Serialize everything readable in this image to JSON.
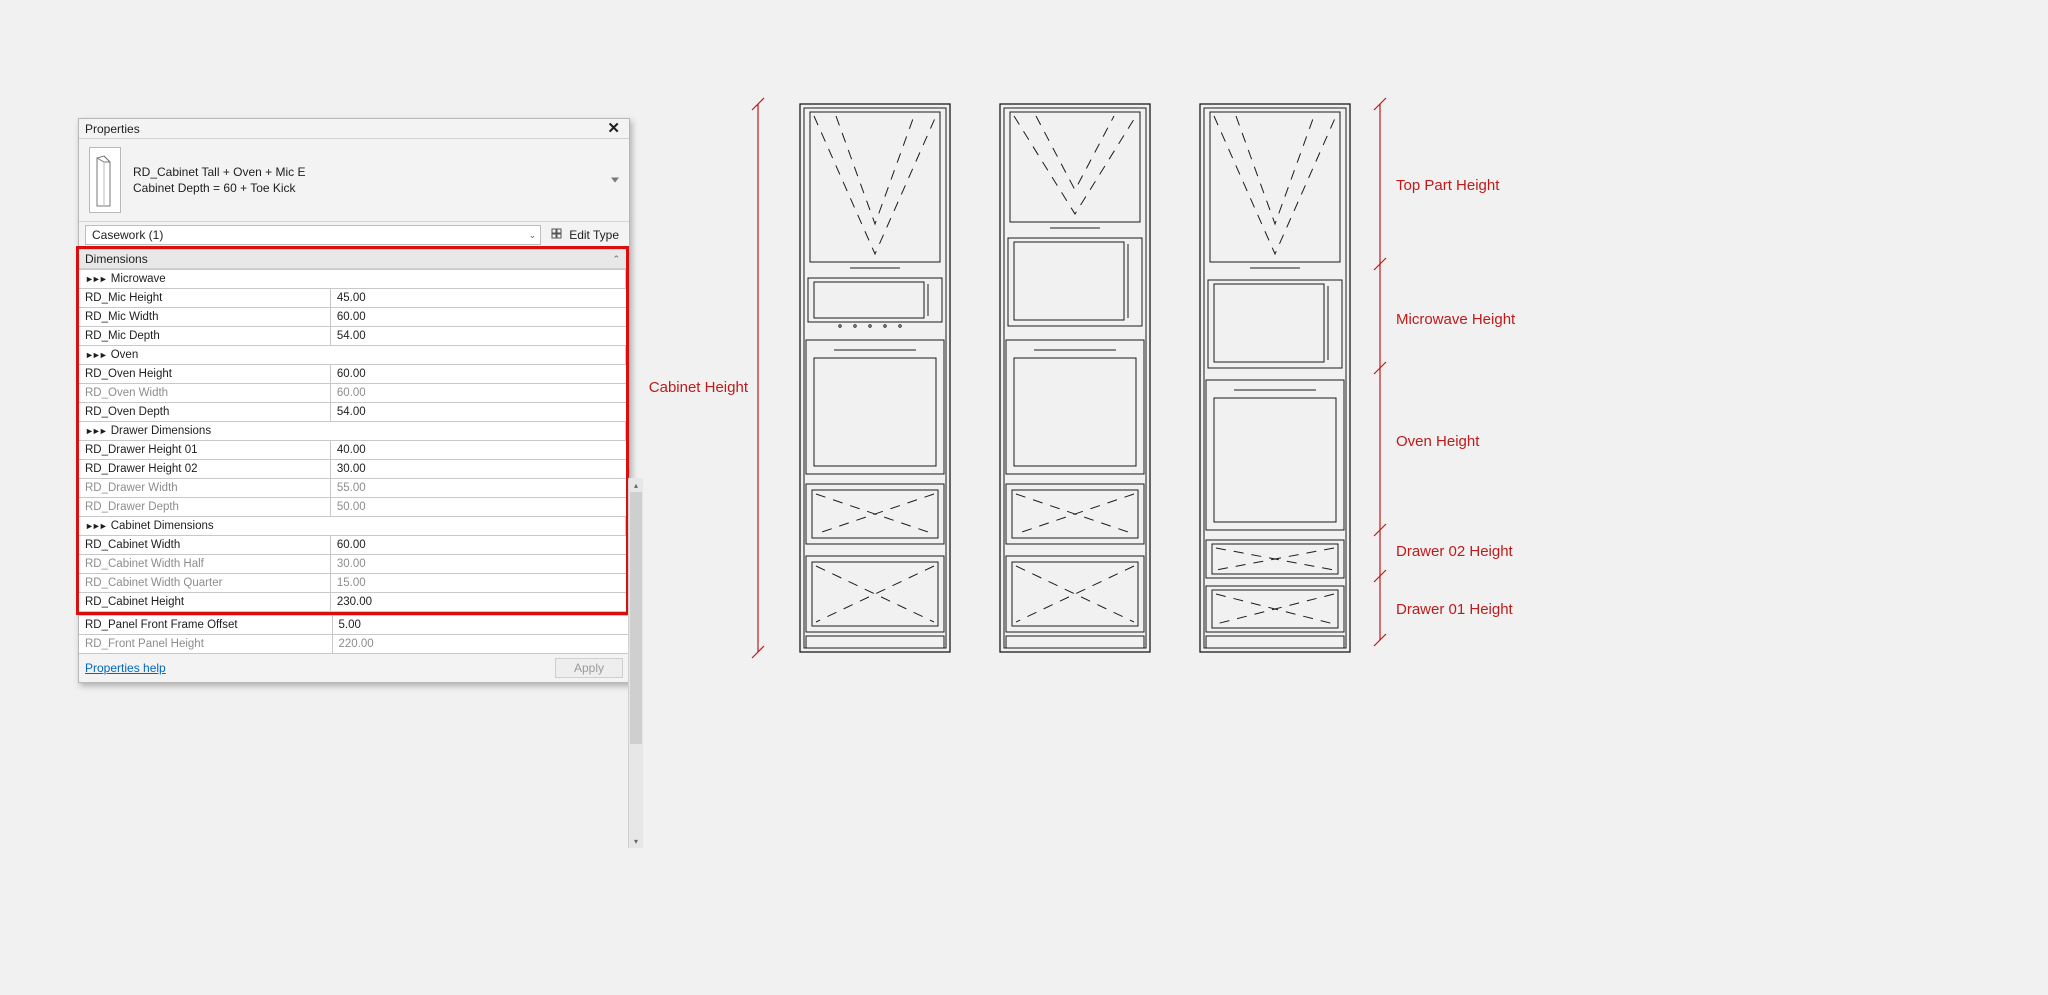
{
  "panel": {
    "title": "Properties",
    "type_name": "RD_Cabinet Tall + Oven + Mic E",
    "type_sub": "Cabinet Depth = 60 + Toe Kick",
    "instance": "Casework (1)",
    "edit_type": "Edit Type",
    "group": "Dimensions",
    "rows": [
      {
        "k": "sep",
        "label": "Microwave"
      },
      {
        "k": "v",
        "label": "RD_Mic Height",
        "value": "45.00"
      },
      {
        "k": "v",
        "label": "RD_Mic Width",
        "value": "60.00"
      },
      {
        "k": "v",
        "label": "RD_Mic Depth",
        "value": "54.00"
      },
      {
        "k": "sep",
        "label": "Oven"
      },
      {
        "k": "v",
        "label": "RD_Oven Height",
        "value": "60.00"
      },
      {
        "k": "vdim",
        "label": "RD_Oven Width",
        "value": "60.00"
      },
      {
        "k": "v",
        "label": "RD_Oven Depth",
        "value": "54.00"
      },
      {
        "k": "sep",
        "label": "Drawer Dimensions"
      },
      {
        "k": "v",
        "label": "RD_Drawer Height 01",
        "value": "40.00"
      },
      {
        "k": "v",
        "label": "RD_Drawer Height 02",
        "value": "30.00"
      },
      {
        "k": "vdim",
        "label": "RD_Drawer Width",
        "value": "55.00"
      },
      {
        "k": "vdim",
        "label": "RD_Drawer Depth",
        "value": "50.00"
      },
      {
        "k": "sep",
        "label": "Cabinet Dimensions"
      },
      {
        "k": "v",
        "label": "RD_Cabinet Width",
        "value": "60.00"
      },
      {
        "k": "vdim",
        "label": "RD_Cabinet Width Half",
        "value": "30.00"
      },
      {
        "k": "vdim",
        "label": "RD_Cabinet Width Quarter",
        "value": "15.00"
      },
      {
        "k": "v",
        "label": "RD_Cabinet Height",
        "value": "230.00"
      }
    ],
    "rows_after": [
      {
        "k": "v",
        "label": "RD_Panel Front Frame Offset",
        "value": "5.00"
      },
      {
        "k": "vdim",
        "label": "RD_Front Panel Height",
        "value": "220.00"
      }
    ],
    "help": "Properties help",
    "apply": "Apply"
  },
  "labels": {
    "cabinet_height": "Cabinet Height",
    "top": "Top Part Height",
    "microwave": "Microwave Height",
    "oven": "Oven Height",
    "drawer2": "Drawer 02 Height",
    "drawer1": "Drawer 01 Height"
  }
}
